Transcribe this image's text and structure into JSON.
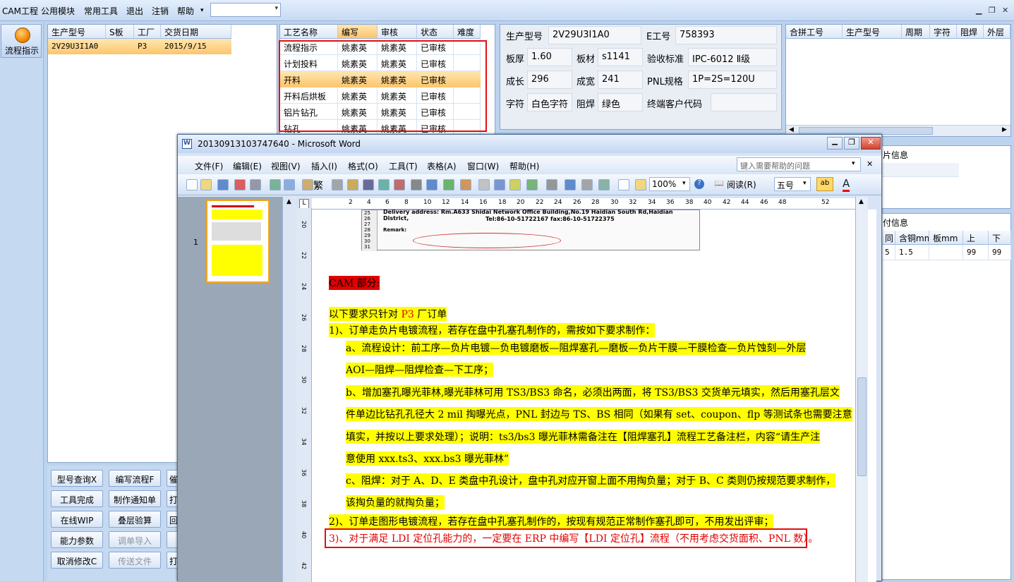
{
  "menu": [
    "CAM工程",
    "公用模块",
    "常用工具",
    "退出",
    "注销",
    "帮助"
  ],
  "flow_button": "流程指示",
  "orders": {
    "headers": [
      "生产型号",
      "S板",
      "工厂",
      "交货日期"
    ],
    "rows": [
      [
        "2V29U3I1A0",
        "",
        "P3",
        "2015/9/15"
      ]
    ]
  },
  "process": {
    "headers": [
      "工艺名称",
      "编写",
      "审核",
      "状态",
      "难度"
    ],
    "rows": [
      [
        "流程指示",
        "姚素英",
        "姚素英",
        "已审核",
        ""
      ],
      [
        "计划投料",
        "姚素英",
        "姚素英",
        "已审核",
        ""
      ],
      [
        "开料",
        "姚素英",
        "姚素英",
        "已审核",
        ""
      ],
      [
        "开料后烘板",
        "姚素英",
        "姚素英",
        "已审核",
        ""
      ],
      [
        "铝片钻孔",
        "姚素英",
        "姚素英",
        "已审核",
        ""
      ],
      [
        "钻孔",
        "姚素英",
        "姚素英",
        "已审核",
        ""
      ]
    ]
  },
  "info": {
    "model_label": "生产型号",
    "model": "2V29U3I1A0",
    "e_label": "E工号",
    "e_no": "758393",
    "thick_label": "板厚",
    "thick": "1.60",
    "mat_label": "板材",
    "mat": "s1141",
    "std_label": "验收标准",
    "std": "IPC-6012 Ⅱ级",
    "len_label": "成长",
    "len": "296",
    "wid_label": "成宽",
    "wid": "241",
    "pnl_label": "PNL规格",
    "pnl": "1P=2S=120U",
    "char_label": "字符",
    "char": "白色字符",
    "mask_label": "阻焊",
    "mask": "绿色",
    "cust_label": "终端客户代码",
    "cust": ""
  },
  "merge": {
    "headers": [
      "合拼工号",
      "生产型号",
      "周期",
      "字符",
      "阻焊",
      "外层"
    ]
  },
  "partial_titles": [
    "片信息",
    "付信息"
  ],
  "copper": {
    "headers": [
      "同",
      "含铜mm",
      "板mm",
      "上",
      "下"
    ],
    "row": [
      "5",
      "1.5",
      "",
      "99",
      "99"
    ]
  },
  "buttons": [
    [
      "型号查询X",
      "编写流程F",
      "催"
    ],
    [
      "工具完成",
      "制作通知单",
      "打"
    ],
    [
      "在线WIP",
      "叠层验算",
      "回"
    ],
    [
      "能力参数",
      "调单导入",
      ""
    ],
    [
      "取消修改C",
      "传送文件",
      "打"
    ]
  ],
  "disabled": [
    "调单导入",
    "传送文件"
  ],
  "word": {
    "title": "20130913103747640 - Microsoft Word",
    "menu": [
      "文件(F)",
      "编辑(E)",
      "视图(V)",
      "插入(I)",
      "格式(O)",
      "工具(T)",
      "表格(A)",
      "窗口(W)",
      "帮助(H)"
    ],
    "help_placeholder": "键入需要帮助的问题",
    "zoom": "100%",
    "read": "阅读(R)",
    "fontsize": "五号",
    "trad": "繁",
    "thumb_no": "1",
    "ruler": [
      "2",
      "4",
      "6",
      "8",
      "10",
      "12",
      "14",
      "16",
      "18",
      "20",
      "22",
      "24",
      "26",
      "28",
      "30",
      "32",
      "34",
      "36",
      "38",
      "40",
      "42",
      "44",
      "46",
      "48",
      "52"
    ],
    "vruler": [
      "20",
      "22",
      "24",
      "26",
      "28",
      "30",
      "32",
      "34",
      "36",
      "38",
      "40",
      "42"
    ],
    "tbl_rows": [
      "25",
      "26",
      "27",
      "28",
      "29",
      "30",
      "31"
    ],
    "tbl_line1": "Delivery address:    Rm.A633 Shidai Network Office Building,No.19 Haidian South Rd,Haidian District,",
    "tbl_line2": "Tel:86-10-51722167 fax:86-10-51722375",
    "tbl_remark": "Remark:",
    "cam_heading": "CAM 部分:",
    "p_intro_a": "以下要求只针对 ",
    "p_intro_b": "P3",
    "p_intro_c": " 厂订单",
    "p1": "1)、订单走负片电镀流程，若存在盘中孔塞孔制作的，需按如下要求制作：",
    "pa1": "a、流程设计：前工序—负片电镀—负电镀磨板—阻焊塞孔—磨板—负片干膜—干膜检查—负片蚀刻—外层",
    "pa2": "AOI—阻焊—阻焊检查—下工序；",
    "pb1": "b、增加塞孔曝光菲林,曝光菲林可用 TS3/BS3 命名，必须出两面，将 TS3/BS3 交货单元填实，然后用塞孔层文",
    "pb2": "件单边比钻孔孔径大 2 mil 掏曝光点，PNL 封边与 TS、BS 相同（如果有 set、coupon、flp 等测试条也需要注意",
    "pb3": "填实，并按以上要求处理）；说明：ts3/bs3 曝光菲林需备注在【阻焊塞孔】流程工艺备注栏，内容“请生产注",
    "pb4": "意使用 xxx.ts3、xxx.bs3 曝光菲林”",
    "pc1": "c、阻焊：对于 A、D、E 类盘中孔设计，盘中孔对应开窗上面不用掏负量；对于 B、C 类则仍按规范要求制作，",
    "pc2": "该掏负量的就掏负量；",
    "p2": "2)、订单走图形电镀流程，若存在盘中孔塞孔制作的，按现有规范正常制作塞孔即可，不用发出评审；",
    "p3": "3)、对于满足 LDI 定位孔能力的，一定要在 ERP 中编写【LDI 定位孔】流程（不用考虑交货面积、PNL 数）。"
  }
}
